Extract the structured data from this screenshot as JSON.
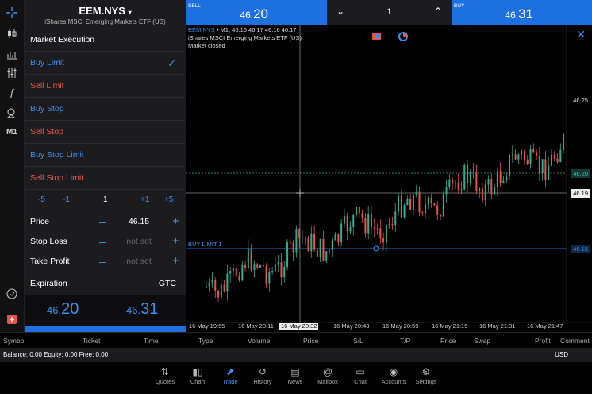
{
  "toolbar_icons": [
    "crosshair-icon",
    "candlestick-icon",
    "bar-chart-icon",
    "indicators-icon",
    "function-icon",
    "objects-icon",
    "timeframe-m1"
  ],
  "timeframe_label": "M1",
  "symbol": {
    "name": "EEM.NYS",
    "description": "iShares MSCI Emerging Markets ETF (US)"
  },
  "order_types": [
    {
      "label": "Market Execution",
      "kind": "hdr"
    },
    {
      "label": "Buy Limit",
      "kind": "blue",
      "selected": true
    },
    {
      "label": "Sell Limit",
      "kind": "red"
    },
    {
      "label": "Buy Stop",
      "kind": "blue"
    },
    {
      "label": "Sell Stop",
      "kind": "red"
    },
    {
      "label": "Buy Stop Limit",
      "kind": "blue"
    },
    {
      "label": "Sell Stop Limit",
      "kind": "red"
    }
  ],
  "steps": {
    "m5": "-5",
    "m1": "-1",
    "volume": "1",
    "p1": "+1",
    "p5": "+5"
  },
  "fields": {
    "price": {
      "label": "Price",
      "value": "46.15"
    },
    "stop_loss": {
      "label": "Stop Loss",
      "placeholder": "not set"
    },
    "take_profit": {
      "label": "Take Profit",
      "placeholder": "not set"
    }
  },
  "expiration": {
    "label": "Expiration",
    "value": "GTC"
  },
  "bid": {
    "big": "46.",
    "small": "20"
  },
  "ask": {
    "big": "46.",
    "small": "31"
  },
  "sell": {
    "title": "SELL",
    "price_a": "46.",
    "price_b": "20"
  },
  "buy": {
    "title": "BUY",
    "price_a": "46.",
    "price_b": "31"
  },
  "lot": {
    "value": "1"
  },
  "chart_info": {
    "line1_symbol": "EEM.NYS",
    "line1_rest": " • M1, 46.16 46.17 46.16 46.17",
    "line2": "iShares MSCI Emerging Markets ETF (US)",
    "line3": "Market closed"
  },
  "price_labels": {
    "p1": "46.25",
    "p2": "46.20",
    "p3": "46.19",
    "p4": "46.15"
  },
  "buy_limit_label": "BUY LIMIT 1",
  "time_labels": [
    "16 May 19:55",
    "16 May 20:11",
    "16 May 20:32",
    "16 May 20:43",
    "16 May 20:59",
    "16 May 21:15",
    "16 May 21:31",
    "16 May 21:47"
  ],
  "columns": [
    "Symbol",
    "Ticket",
    "Time",
    "Type",
    "Volume",
    "Price",
    "S/L",
    "T/P",
    "Price",
    "Swap",
    "Profit",
    "Comment"
  ],
  "balance": {
    "text": "Balance: 0.00 Equity: 0.00 Free: 0.00",
    "currency": "USD"
  },
  "nav": [
    "Quotes",
    "Chart",
    "Trade",
    "History",
    "News",
    "Mailbox",
    "Chat",
    "Accounts",
    "Settings"
  ],
  "nav_active": "Trade",
  "colors": {
    "accent": "#1e6fe0",
    "up": "#2fae8e",
    "down": "#e8534d"
  },
  "chart_data": {
    "type": "candlestick",
    "timeframe": "M1",
    "ohlc_last": [
      46.16,
      46.17,
      46.16,
      46.17
    ],
    "price_levels": {
      "bid": 46.2,
      "crosshair": 46.19,
      "buy_limit": 46.15
    },
    "y_ticks": [
      46.25,
      46.2,
      46.19,
      46.15
    ],
    "x_ticks": [
      "16 May 19:55",
      "16 May 20:11",
      "16 May 20:32",
      "16 May 20:43",
      "16 May 20:59",
      "16 May 21:15",
      "16 May 21:31",
      "16 May 21:47"
    ]
  }
}
